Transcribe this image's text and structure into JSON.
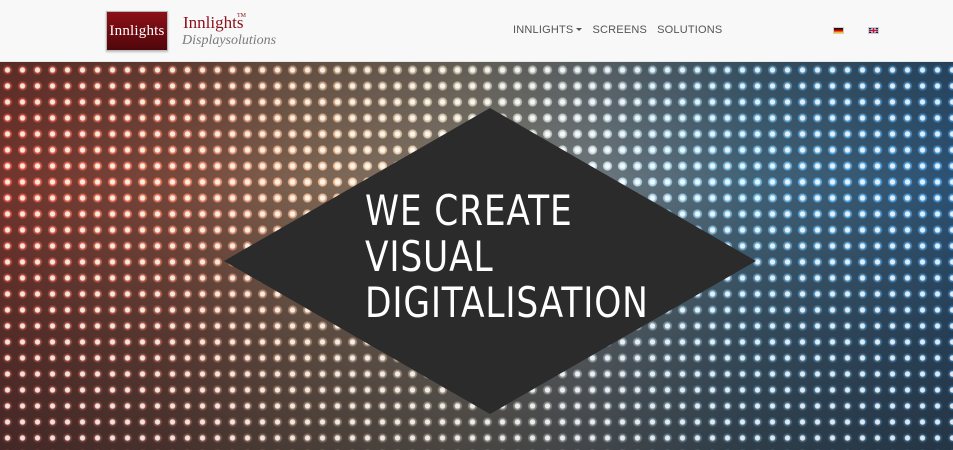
{
  "navbar": {
    "logo_text": "Innlights",
    "brand_name": "Innlights",
    "brand_superscript": "TM",
    "brand_tagline": "Displaysolutions",
    "menu": [
      {
        "label": "INNLIGHTS",
        "has_dropdown": true
      },
      {
        "label": "SCREENS"
      },
      {
        "label": "SOLUTIONS"
      }
    ],
    "languages": [
      {
        "icon": "german-flag-icon"
      },
      {
        "icon": "uk-flag-icon"
      }
    ]
  },
  "hero": {
    "headline": [
      "WE CREATE",
      "VISUAL",
      "DIGITALISATION"
    ],
    "colors": {
      "diamond": "#2b2b2b",
      "brand_red": "#8b1018"
    }
  }
}
